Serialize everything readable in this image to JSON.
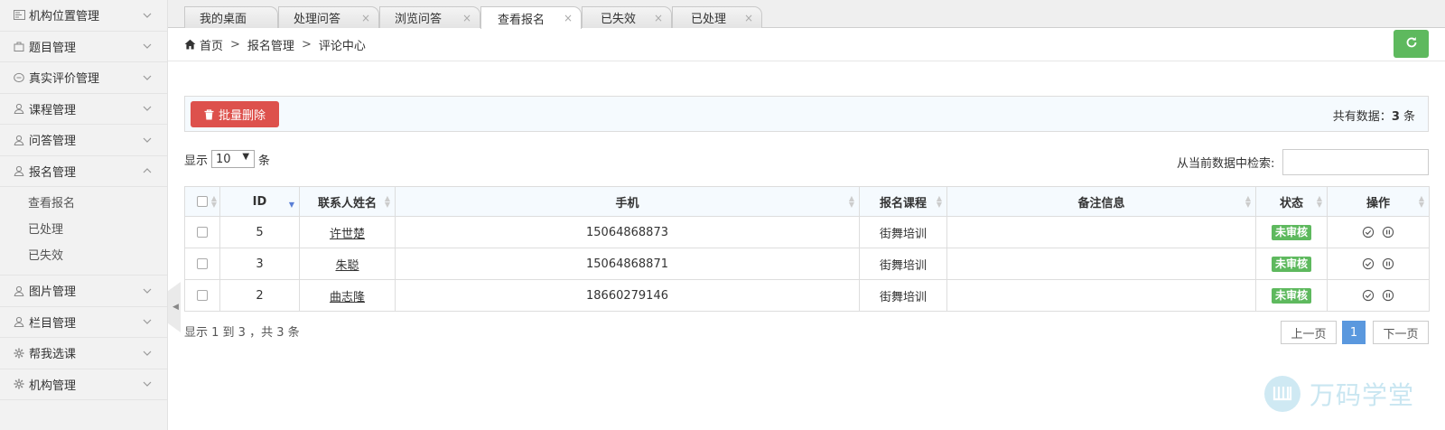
{
  "sidebar": {
    "items": [
      {
        "label": "机构位置管理",
        "icon": "map-icon"
      },
      {
        "label": "题目管理",
        "icon": "bag-icon"
      },
      {
        "label": "真实评价管理",
        "icon": "comment-icon"
      },
      {
        "label": "课程管理",
        "icon": "user-icon"
      },
      {
        "label": "问答管理",
        "icon": "user-icon"
      },
      {
        "label": "报名管理",
        "icon": "user-icon",
        "expanded": true
      },
      {
        "label": "图片管理",
        "icon": "user-icon"
      },
      {
        "label": "栏目管理",
        "icon": "user-icon"
      },
      {
        "label": "帮我选课",
        "icon": "gear-icon"
      },
      {
        "label": "机构管理",
        "icon": "gear-icon"
      }
    ],
    "sub_items": [
      "查看报名",
      "已处理",
      "已失效"
    ]
  },
  "tabs": [
    {
      "label": "我的桌面",
      "closable": false
    },
    {
      "label": "处理问答",
      "closable": true
    },
    {
      "label": "浏览问答",
      "closable": true
    },
    {
      "label": "查看报名",
      "closable": true,
      "active": true
    },
    {
      "label": "已失效",
      "closable": true
    },
    {
      "label": "已处理",
      "closable": true
    }
  ],
  "tab_close_glyph": "×",
  "breadcrumb": {
    "home": "首页",
    "sep": ">",
    "level1": "报名管理",
    "level2": "评论中心"
  },
  "actions": {
    "batch_delete": "批量删除"
  },
  "total": {
    "prefix": "共有数据：",
    "count": "3",
    "suffix": " 条"
  },
  "length": {
    "prefix": "显示",
    "value": "10",
    "suffix": "条"
  },
  "search": {
    "label": "从当前数据中检索:",
    "value": ""
  },
  "table": {
    "headers": [
      "ID",
      "联系人姓名",
      "手机",
      "报名课程",
      "备注信息",
      "状态",
      "操作"
    ],
    "rows": [
      {
        "id": "5",
        "name": "许世楚",
        "phone": "15064868873",
        "course": "街舞培训",
        "note": "",
        "status": "未审核"
      },
      {
        "id": "3",
        "name": "朱聪",
        "phone": "15064868871",
        "course": "街舞培训",
        "note": "",
        "status": "未审核"
      },
      {
        "id": "2",
        "name": "曲志隆",
        "phone": "18660279146",
        "course": "街舞培训",
        "note": "",
        "status": "未审核"
      }
    ]
  },
  "info": "显示 1 到 3 ，共 3 条",
  "pagination": {
    "prev": "上一页",
    "current": "1",
    "next": "下一页"
  },
  "watermark": "万码学堂",
  "colors": {
    "accent": "#5eb95e",
    "danger": "#dd514c",
    "page_active": "#5a98de"
  }
}
